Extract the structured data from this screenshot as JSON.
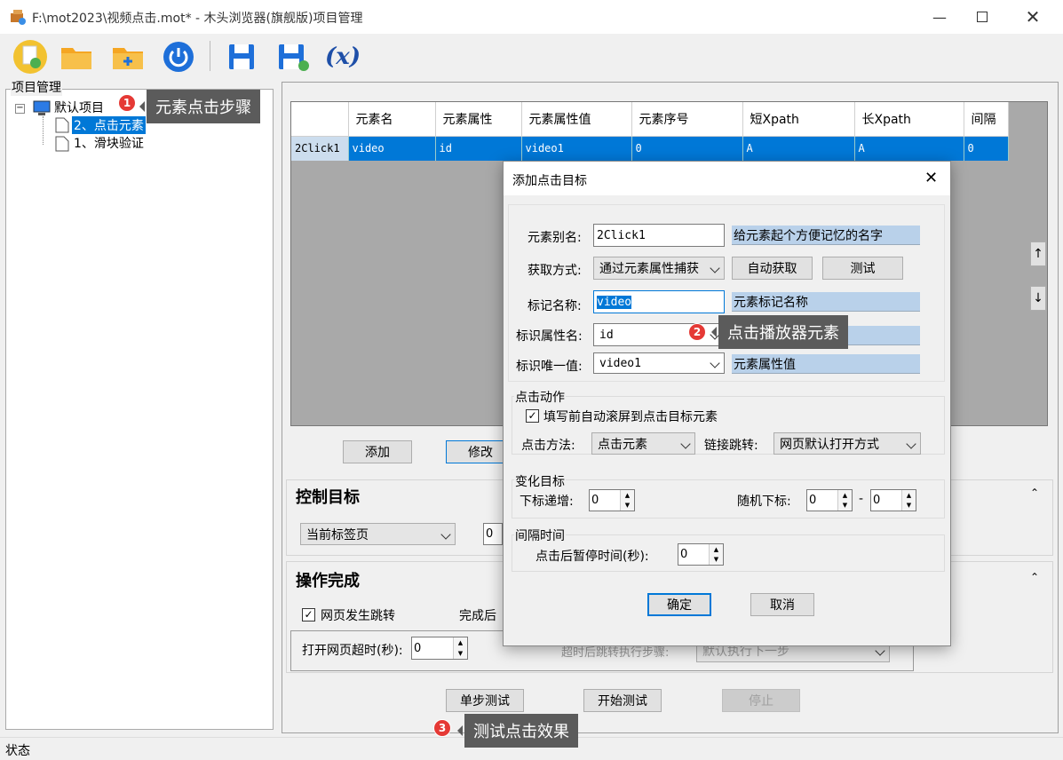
{
  "window": {
    "title": "F:\\mot2023\\视频点击.mot* - 木头浏览器(旗舰版)项目管理"
  },
  "toolbar": {
    "formula_label": "(x)"
  },
  "project_panel": {
    "label": "项目管理",
    "root": "默认项目",
    "items": [
      "2、点击元素",
      "1、滑块验证"
    ]
  },
  "callouts": [
    {
      "num": "1",
      "text": "元素点击步骤"
    },
    {
      "num": "2",
      "text": "点击播放器元素"
    },
    {
      "num": "3",
      "text": "测试点击效果"
    }
  ],
  "grid": {
    "columns": [
      "",
      "元素名",
      "元素属性",
      "元素属性值",
      "元素序号",
      "短Xpath",
      "长Xpath",
      "间隔"
    ],
    "rows": [
      [
        "2Click1",
        "video",
        "id",
        "video1",
        "0",
        "A",
        "A",
        "0"
      ]
    ]
  },
  "main_buttons": {
    "add": "添加",
    "edit": "修改"
  },
  "control_target": {
    "title": "控制目标",
    "tab_select": "当前标签页",
    "value": "0"
  },
  "operation_done": {
    "title": "操作完成",
    "jump_check_label": "网页发生跳转",
    "after_label": "完成后",
    "timeout_label": "打开网页超时(秒):",
    "timeout_value": "0",
    "after_jump_label": "超时后跳转执行步骤:",
    "after_jump_value": "默认执行下一步"
  },
  "bottom_buttons": {
    "single_test": "单步测试",
    "start_test": "开始测试",
    "stop": "停止"
  },
  "status": {
    "label": "状态"
  },
  "dialog": {
    "title": "添加点击目标",
    "alias_label": "元素别名:",
    "alias_value": "2Click1",
    "alias_hint": "给元素起个方便记忆的名字",
    "method_label": "获取方式:",
    "method_value": "通过元素属性捕获",
    "auto_btn": "自动获取",
    "test_btn": "测试",
    "tag_label": "标记名称:",
    "tag_value": "video",
    "tag_hint": "元素标记名称",
    "attr_label": "标识属性名:",
    "attr_value": "id",
    "unique_label": "标识唯一值:",
    "unique_value": "video1",
    "unique_hint": "元素属性值",
    "click_group": "点击动作",
    "scroll_check": "填写前自动滚屏到点击目标元素",
    "click_method_label": "点击方法:",
    "click_method_value": "点击元素",
    "link_label": "链接跳转:",
    "link_value": "网页默认打开方式",
    "change_group": "变化目标",
    "index_label": "下标递增:",
    "index_value": "0",
    "random_label": "随机下标:",
    "random_from": "0",
    "random_to": "0",
    "dash": "-",
    "interval_group": "间隔时间",
    "pause_label": "点击后暂停时间(秒):",
    "pause_value": "0",
    "ok": "确定",
    "cancel": "取消"
  }
}
